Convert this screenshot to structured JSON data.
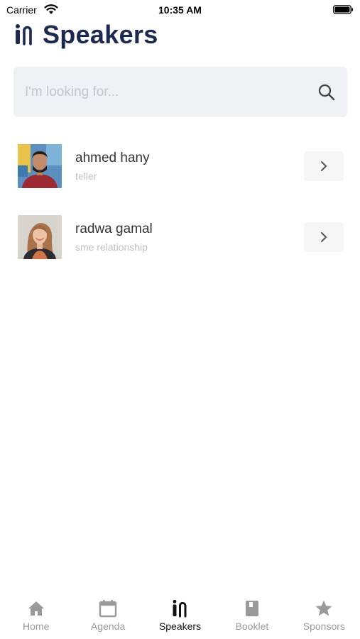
{
  "status_bar": {
    "carrier": "Carrier",
    "time": "10:35 AM"
  },
  "header": {
    "title": "Speakers",
    "icon": "speakers-logo-icon"
  },
  "search": {
    "placeholder": "I'm looking for...",
    "value": "",
    "icon": "search-icon"
  },
  "speakers": [
    {
      "name": "ahmed hany",
      "role": "teller"
    },
    {
      "name": "radwa gamal",
      "role": "sme relationship"
    }
  ],
  "tab_bar": {
    "tabs": [
      {
        "label": "Home",
        "icon": "home-icon",
        "active": false
      },
      {
        "label": "Agenda",
        "icon": "calendar-icon",
        "active": false
      },
      {
        "label": "Speakers",
        "icon": "speakers-icon",
        "active": true
      },
      {
        "label": "Booklet",
        "icon": "book-icon",
        "active": false
      },
      {
        "label": "Sponsors",
        "icon": "star-icon",
        "active": false
      }
    ]
  },
  "colors": {
    "title": "#1c2a52",
    "search_bg": "#f0f1f4",
    "tab_inactive": "#9a9a9a",
    "tab_active": "#111111"
  }
}
